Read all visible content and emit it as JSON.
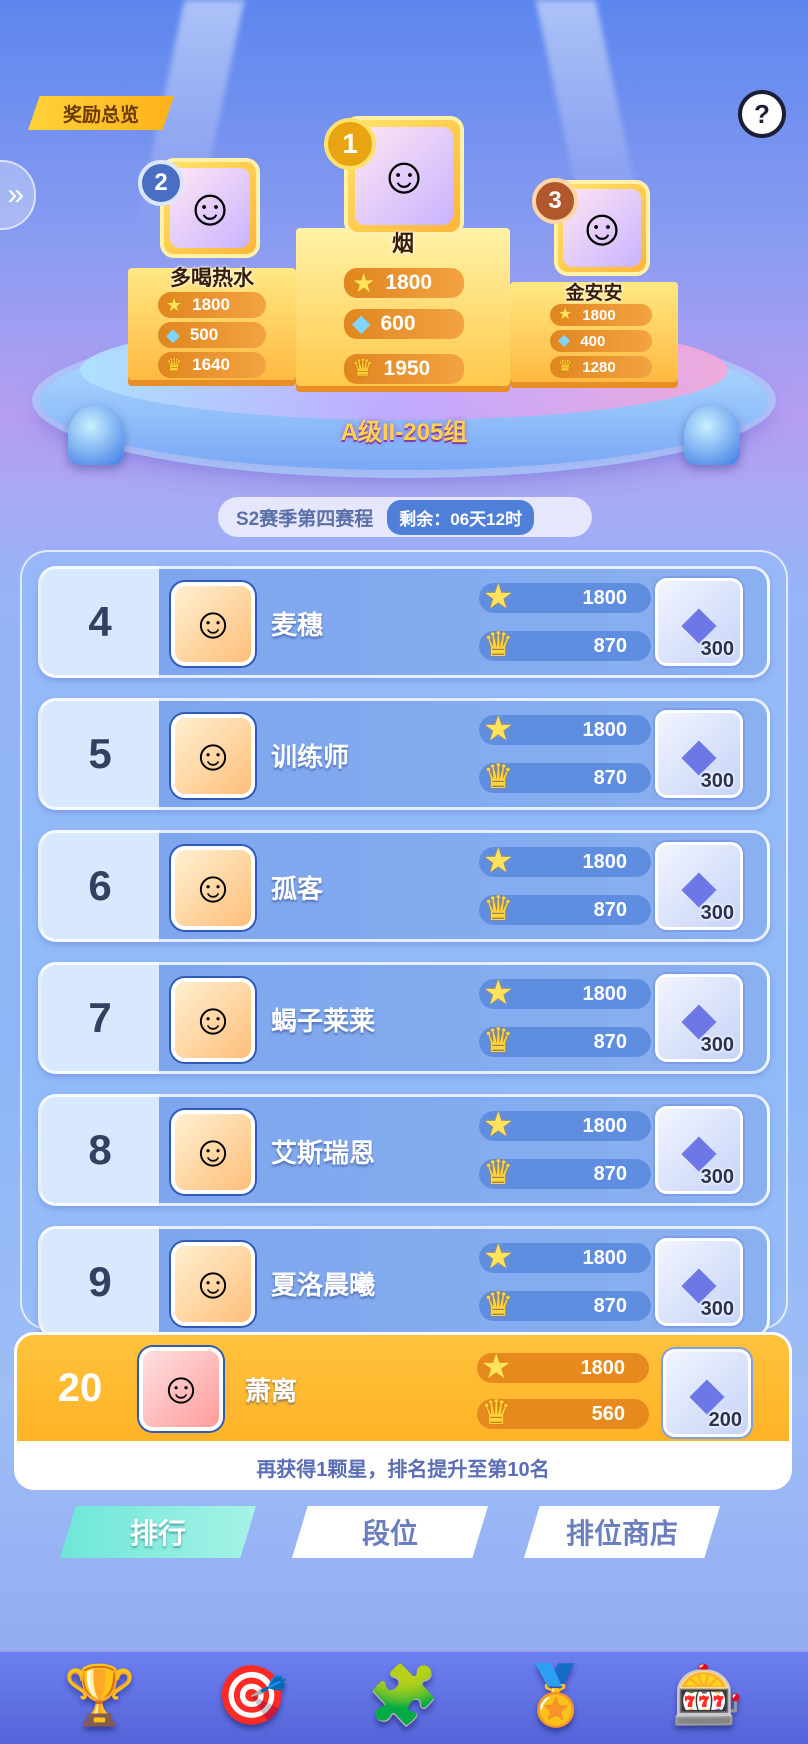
{
  "header": {
    "reward_overview": "奖励总览",
    "help": "?"
  },
  "podium": {
    "first": {
      "rank": "1",
      "name": "烟",
      "stars": "1800",
      "gems": "600",
      "crowns": "1950"
    },
    "second": {
      "rank": "2",
      "name": "多喝热水",
      "stars": "1800",
      "gems": "500",
      "crowns": "1640"
    },
    "third": {
      "rank": "3",
      "name": "金安安",
      "stars": "1800",
      "gems": "400",
      "crowns": "1280"
    },
    "group": "A级II-205组"
  },
  "season": {
    "title": "S2赛季第四赛程",
    "remaining": "剩余：06天12时"
  },
  "rows": [
    {
      "rank": "4",
      "name": "麦穗",
      "stars": "1800",
      "crowns": "870",
      "reward": "300"
    },
    {
      "rank": "5",
      "name": "训练师",
      "stars": "1800",
      "crowns": "870",
      "reward": "300"
    },
    {
      "rank": "6",
      "name": "孤客",
      "stars": "1800",
      "crowns": "870",
      "reward": "300"
    },
    {
      "rank": "7",
      "name": "蝎子莱莱",
      "stars": "1800",
      "crowns": "870",
      "reward": "300"
    },
    {
      "rank": "8",
      "name": "艾斯瑞恩",
      "stars": "1800",
      "crowns": "870",
      "reward": "300"
    },
    {
      "rank": "9",
      "name": "夏洛晨曦",
      "stars": "1800",
      "crowns": "870",
      "reward": "300"
    }
  ],
  "me": {
    "rank": "20",
    "name": "萧离",
    "stars": "1800",
    "crowns": "560",
    "reward": "200"
  },
  "tip": "再获得1颗星，排名提升至第10名",
  "tabs": [
    "排行",
    "段位",
    "排位商店"
  ],
  "icons": {
    "star": "★",
    "gem": "◆",
    "crown": "♛",
    "avatar": "☺",
    "nav": [
      "🏆",
      "🎯",
      "🧩",
      "🏅",
      "🎰"
    ]
  }
}
